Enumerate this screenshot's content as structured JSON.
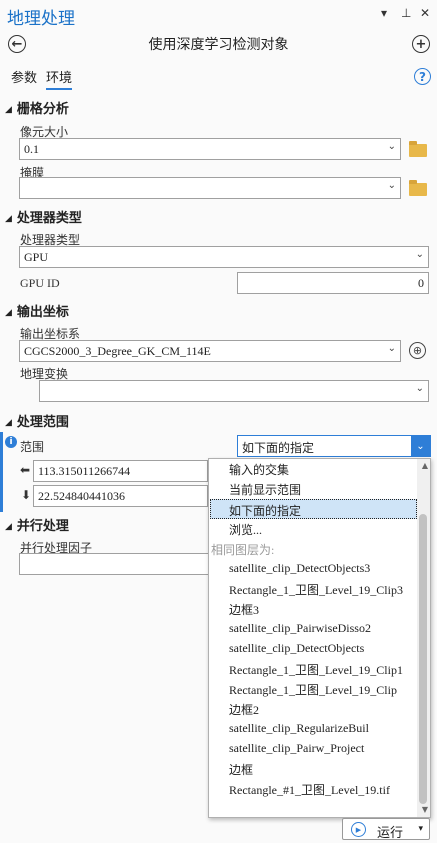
{
  "window": {
    "title": "地理处理",
    "menu_icon": "▾",
    "pin_icon": "⊥",
    "close_icon": "✕"
  },
  "tool": {
    "title": "使用深度学习检测对象",
    "back_icon": "←",
    "add_icon": "+"
  },
  "tabs": [
    {
      "label": "参数"
    },
    {
      "label": "环境"
    }
  ],
  "help_icon": "?",
  "sections": {
    "raster": {
      "header": "栅格分析",
      "cell_size_label": "像元大小",
      "cell_size_value": "0.1",
      "mask_label": "掩膜",
      "mask_value": ""
    },
    "processor": {
      "header": "处理器类型",
      "type_label": "处理器类型",
      "type_value": "GPU",
      "gpu_id_label": "GPU ID",
      "gpu_id_value": "0"
    },
    "output_coords": {
      "header": "输出坐标",
      "coord_system_label": "输出坐标系",
      "coord_system_value": "CGCS2000_3_Degree_GK_CM_114E",
      "geo_transform_label": "地理变换",
      "geo_transform_value": ""
    },
    "extent": {
      "header": "处理范围",
      "extent_label": "范围",
      "extent_value": "如下面的指定",
      "x_value": "113.315011266744",
      "y_value": "22.524840441036"
    },
    "parallel": {
      "header": "并行处理",
      "factor_label": "并行处理因子",
      "factor_value": ""
    }
  },
  "dropdown": {
    "options": [
      {
        "label": "输入的交集"
      },
      {
        "label": "当前显示范围"
      },
      {
        "label": "如下面的指定"
      },
      {
        "label": "浏览..."
      }
    ],
    "selected_index": 2,
    "layers_header": "相同图层为:",
    "layers": [
      "satellite_clip_DetectObjects3",
      "Rectangle_1_卫图_Level_19_Clip3",
      "边框3",
      "satellite_clip_PairwiseDisso2",
      "satellite_clip_DetectObjects",
      "Rectangle_1_卫图_Level_19_Clip1",
      "Rectangle_1_卫图_Level_19_Clip",
      "边框2",
      "satellite_clip_RegularizeBuil",
      "satellite_clip_Pairw_Project",
      "边框",
      "Rectangle_#1_卫图_Level_19.tif"
    ]
  },
  "run_button": {
    "label": "运行",
    "play_icon": "▶",
    "dropdown_icon": "▾"
  },
  "colors": {
    "accent": "#2e7ed7",
    "title": "#1b72c8"
  }
}
